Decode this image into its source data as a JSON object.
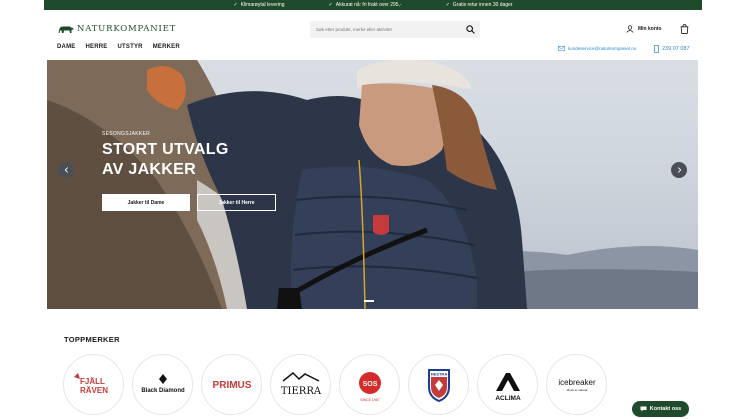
{
  "usp_bar": {
    "items": [
      {
        "icon": "check-icon",
        "text": "Klimarøytal levering"
      },
      {
        "icon": "check-icon",
        "text": "Akkurat nå: fri frakt over 295,-"
      },
      {
        "icon": "check-icon",
        "text": "Gratis retur innen 30 dager"
      }
    ]
  },
  "header": {
    "logo_text": "NATURKOMPANIET",
    "search_placeholder": "Søk etter produkt, merke eller aktivitet",
    "account_label": "Min konto",
    "nav": [
      "DAME",
      "HERRE",
      "UTSTYR",
      "MERKER"
    ],
    "email": "kundeservice@naturkompaniet.no",
    "phone": "239 07 087"
  },
  "hero": {
    "eyebrow": "SESONGSJAKKER",
    "title": "STORT UTVALG AV JAKKER",
    "button_primary": "Jakker til Dame",
    "button_secondary": "Jakker til Herre",
    "slide_indicator": {
      "count": 1,
      "active": 0
    }
  },
  "brands": {
    "title": "TOPPMERKER",
    "items": [
      "FJÄLLRÄVEN",
      "Black Diamond",
      "PRIMUS",
      "TIERRA",
      "SOS",
      "HESTRA",
      "ACLIMA",
      "icebreaker"
    ]
  },
  "chat": {
    "label": "Kontakt oss"
  },
  "colors": {
    "brand_green": "#1f4a2b",
    "link_blue": "#2a8ad0"
  }
}
